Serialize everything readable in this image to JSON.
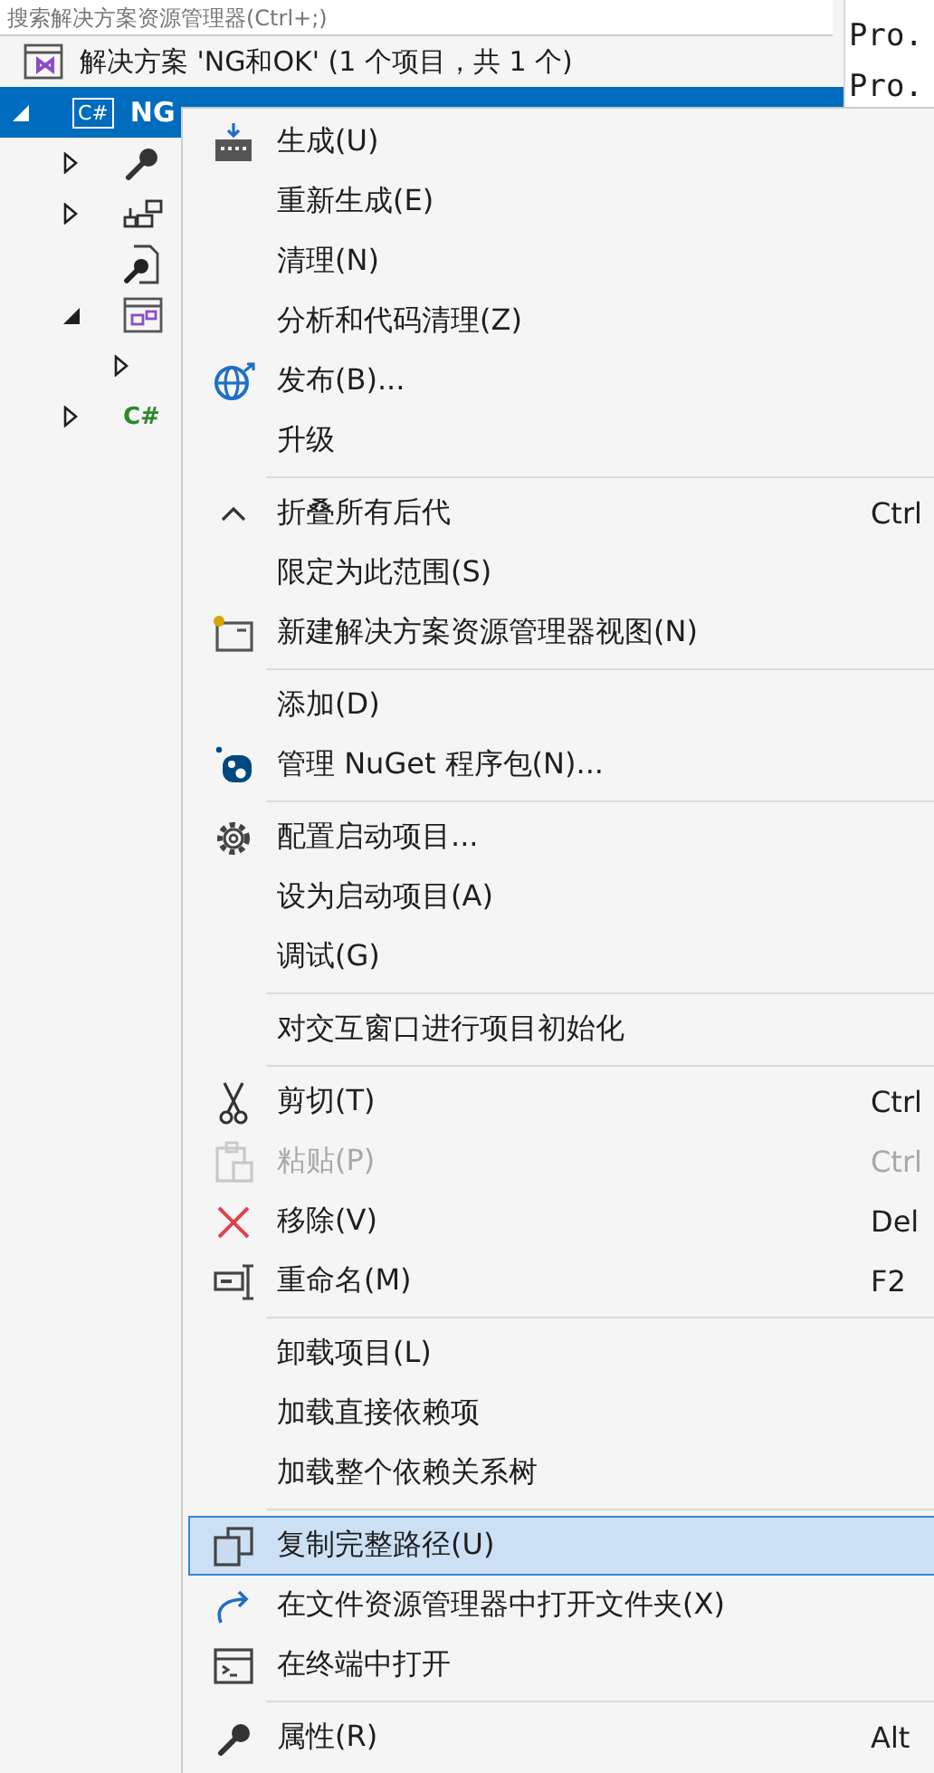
{
  "search": {
    "placeholder": "搜索解决方案资源管理器(Ctrl+;)"
  },
  "tree": [
    {
      "kind": "solution",
      "label": "解决方案 'NG和OK' (1 个项目，共 1 个)",
      "selected": false,
      "children": [
        {
          "kind": "project",
          "expanded": true,
          "icon_text": "C#",
          "label": "NG",
          "selected": true,
          "children": [
            {
              "kind": "properties",
              "expanded": false,
              "selected": false
            },
            {
              "kind": "dependencies",
              "expanded": false,
              "selected": false
            },
            {
              "kind": "settings",
              "selected": false
            },
            {
              "kind": "form",
              "expanded": true,
              "selected": false,
              "children": [
                {
                  "expanded": false,
                  "selected": false
                }
              ]
            },
            {
              "kind": "csharp-file",
              "expanded": false,
              "icon_text": "C#",
              "selected": false
            }
          ]
        }
      ]
    }
  ],
  "code_lines": [
    "Pro.",
    "Pro."
  ],
  "menu": [
    {
      "kind": "build",
      "label": "生成(U)",
      "disabled": false,
      "selected": false
    },
    {
      "kind": "plain",
      "label": "重新生成(E)",
      "disabled": false,
      "selected": false
    },
    {
      "kind": "plain",
      "label": "清理(N)",
      "disabled": false,
      "selected": false
    },
    {
      "kind": "plain",
      "label": "分析和代码清理(Z)",
      "disabled": false,
      "selected": false
    },
    {
      "kind": "publish",
      "label": "发布(B)...",
      "disabled": false,
      "selected": false
    },
    {
      "kind": "plain",
      "label": "升级",
      "disabled": false,
      "selected": false
    },
    {
      "kind": "separator"
    },
    {
      "kind": "collapse",
      "label": "折叠所有后代",
      "shortcut": "Ctrl",
      "disabled": false,
      "selected": false
    },
    {
      "kind": "plain",
      "label": "限定为此范围(S)",
      "disabled": false,
      "selected": false
    },
    {
      "kind": "new-view",
      "label": "新建解决方案资源管理器视图(N)",
      "disabled": false,
      "selected": false
    },
    {
      "kind": "separator"
    },
    {
      "kind": "plain",
      "label": "添加(D)",
      "disabled": false,
      "selected": false
    },
    {
      "kind": "nuget",
      "label": "管理 NuGet 程序包(N)...",
      "disabled": false,
      "selected": false
    },
    {
      "kind": "separator"
    },
    {
      "kind": "configure",
      "label": "配置启动项目...",
      "disabled": false,
      "selected": false
    },
    {
      "kind": "plain",
      "label": "设为启动项目(A)",
      "disabled": false,
      "selected": false
    },
    {
      "kind": "plain",
      "label": "调试(G)",
      "disabled": false,
      "selected": false
    },
    {
      "kind": "separator"
    },
    {
      "kind": "plain",
      "label": "对交互窗口进行项目初始化",
      "disabled": false,
      "selected": false
    },
    {
      "kind": "separator"
    },
    {
      "kind": "cut",
      "label": "剪切(T)",
      "shortcut": "Ctrl",
      "disabled": false,
      "selected": false
    },
    {
      "kind": "paste",
      "label": "粘贴(P)",
      "shortcut": "Ctrl",
      "disabled": true,
      "selected": false
    },
    {
      "kind": "remove",
      "label": "移除(V)",
      "shortcut": "Del",
      "disabled": false,
      "selected": false
    },
    {
      "kind": "rename",
      "label": "重命名(M)",
      "shortcut": "F2",
      "disabled": false,
      "selected": false
    },
    {
      "kind": "separator"
    },
    {
      "kind": "plain",
      "label": "卸载项目(L)",
      "disabled": false,
      "selected": false
    },
    {
      "kind": "plain",
      "label": "加载直接依赖项",
      "disabled": false,
      "selected": false
    },
    {
      "kind": "plain",
      "label": "加载整个依赖关系树",
      "disabled": false,
      "selected": false
    },
    {
      "kind": "separator"
    },
    {
      "kind": "copy",
      "label": "复制完整路径(U)",
      "disabled": false,
      "selected": true
    },
    {
      "kind": "open-folder",
      "label": "在文件资源管理器中打开文件夹(X)",
      "disabled": false,
      "selected": false
    },
    {
      "kind": "terminal",
      "label": "在终端中打开",
      "disabled": false,
      "selected": false
    },
    {
      "kind": "separator"
    },
    {
      "kind": "properties",
      "label": "属性(R)",
      "shortcut": "Alt",
      "disabled": false,
      "selected": false
    }
  ]
}
